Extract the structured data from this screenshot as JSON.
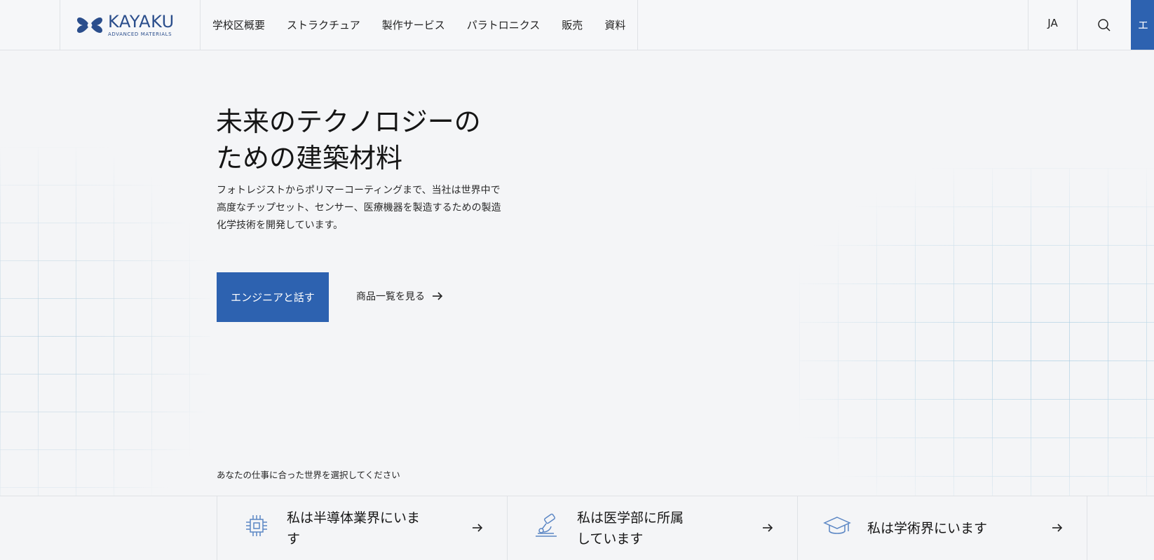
{
  "brand": {
    "name": "KAYAKU",
    "tagline": "ADVANCED MATERIALS",
    "color": "#2b4e8c"
  },
  "nav": {
    "items": [
      {
        "label": "学校区概要"
      },
      {
        "label": "ストラクチュア"
      },
      {
        "label": "製作サービス"
      },
      {
        "label": "パラトロニクス"
      },
      {
        "label": "販売"
      },
      {
        "label": "資料"
      }
    ],
    "lang": "JA",
    "search_icon": "search-icon",
    "cta_label": "エ"
  },
  "hero": {
    "title_line1": "未来のテクノロジーの",
    "title_line2": "ための建築材料",
    "desc_line1": "フォトレジストからポリマーコーティングまで、当社は世界中で",
    "desc_line2": "高度なチップセット、センサー、医療機器を製造するための製造",
    "desc_line3": "化学技術を開発しています。",
    "primary_button": "エンジニアと話す",
    "secondary_link": "商品一覧を見る",
    "accent_color": "#2d62b0"
  },
  "selector": {
    "label": "あなたの仕事に合った世界を選択してください",
    "cards": [
      {
        "line1": "私は半導体業界にいます",
        "line2": "",
        "icon": "chip-icon"
      },
      {
        "line1": "私は医学部に所属",
        "line2": "しています",
        "icon": "microscope-icon"
      },
      {
        "line1": "私は学術界にいます",
        "line2": "",
        "icon": "graduation-cap-icon"
      }
    ]
  }
}
